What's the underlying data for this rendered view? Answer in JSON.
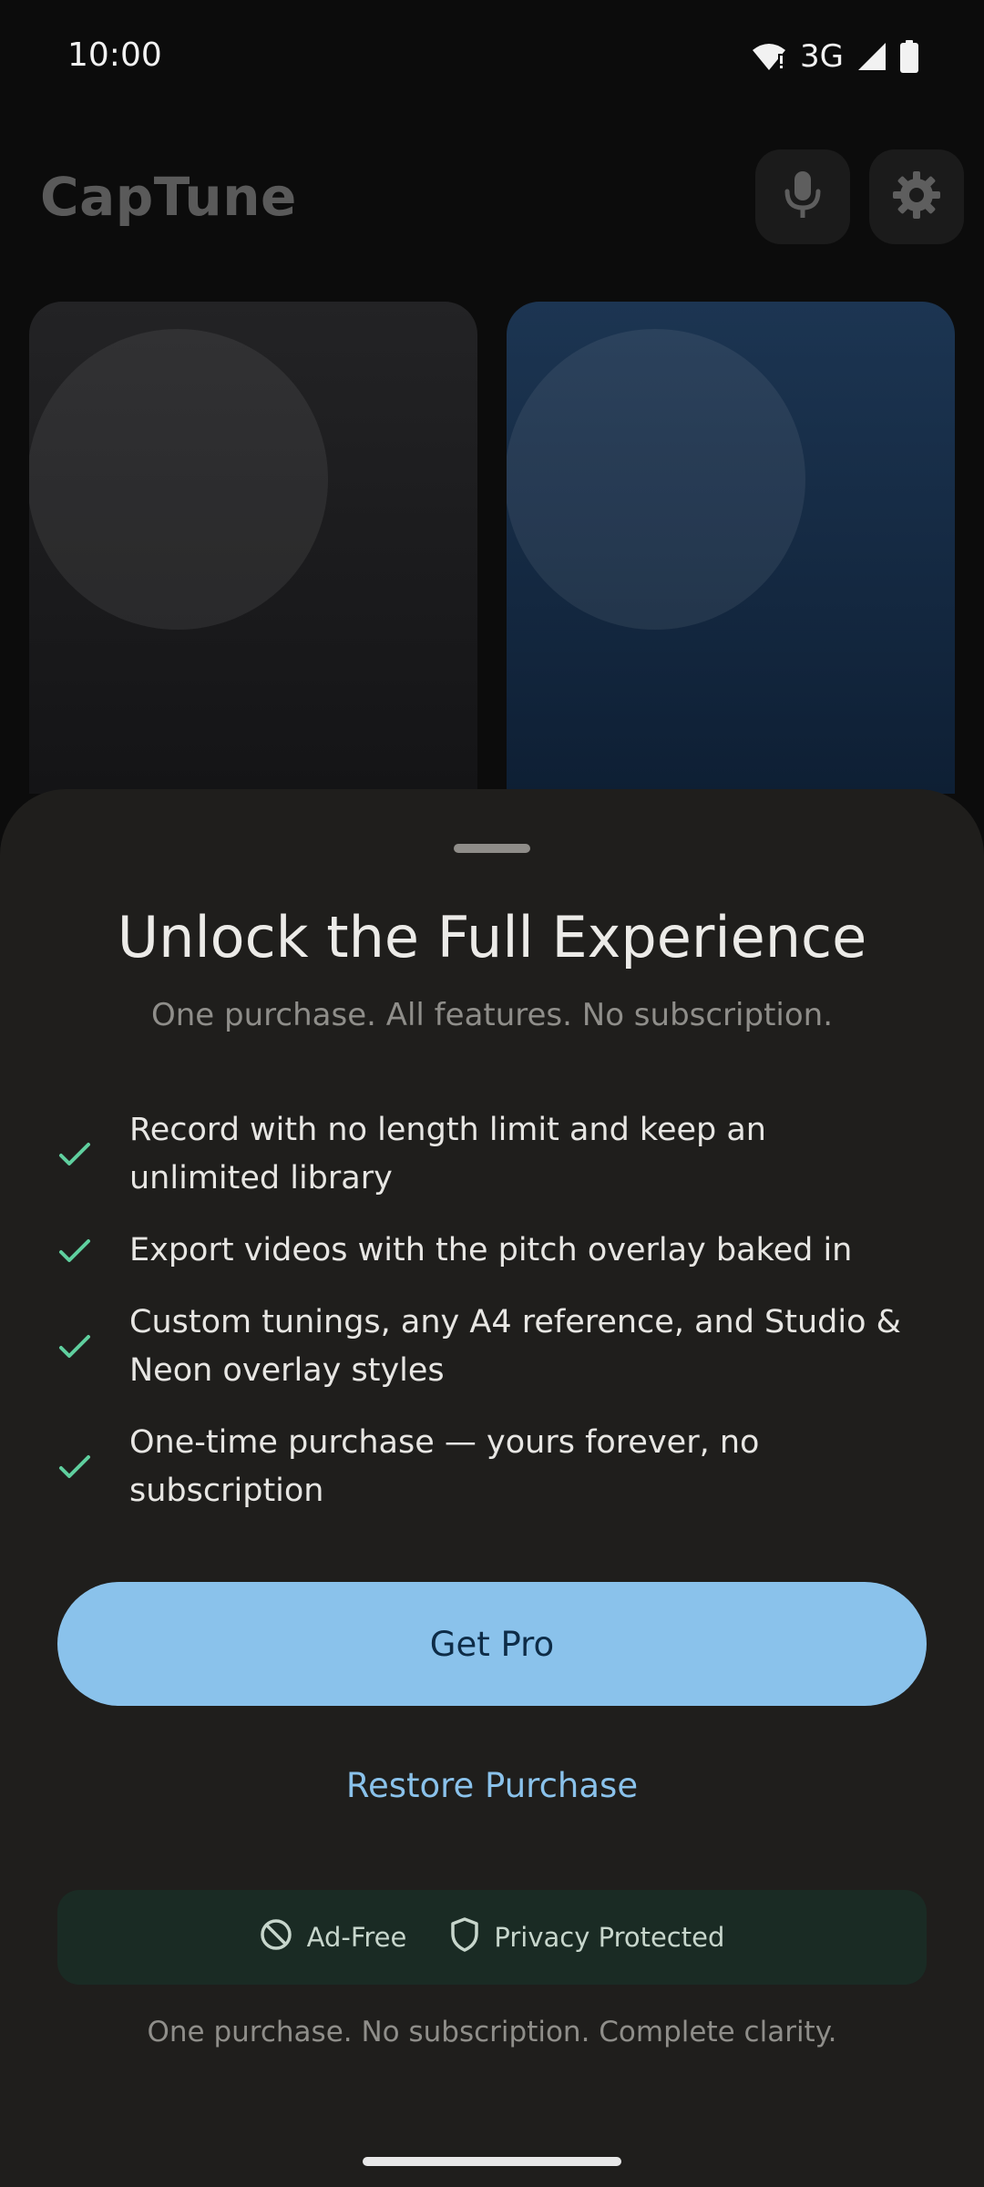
{
  "status_bar": {
    "time": "10:00",
    "network": "3G"
  },
  "app": {
    "title": "CapTune"
  },
  "paywall": {
    "title": "Unlock the Full Experience",
    "subtitle": "One purchase. All features. No subscription.",
    "features": [
      "Record with no length limit and keep an unlimited library",
      "Export videos with the pitch overlay baked in",
      "Custom tunings, any A4 reference, and Studio & Neon overlay styles",
      "One-time purchase — yours forever, no subscription"
    ],
    "primary_button": "Get Pro",
    "restore_button": "Restore Purchase",
    "badges": [
      "Ad-Free",
      "Privacy Protected"
    ],
    "footer": "One purchase. No subscription. Complete clarity."
  },
  "colors": {
    "accent": "#8ac2eb",
    "check": "#5fcf9e",
    "sheet_bg": "#1f1e1c"
  },
  "icons": [
    "wifi-icon",
    "signal-icon",
    "battery-icon",
    "mic-icon",
    "gear-icon",
    "check-icon",
    "block-icon",
    "shield-icon"
  ]
}
